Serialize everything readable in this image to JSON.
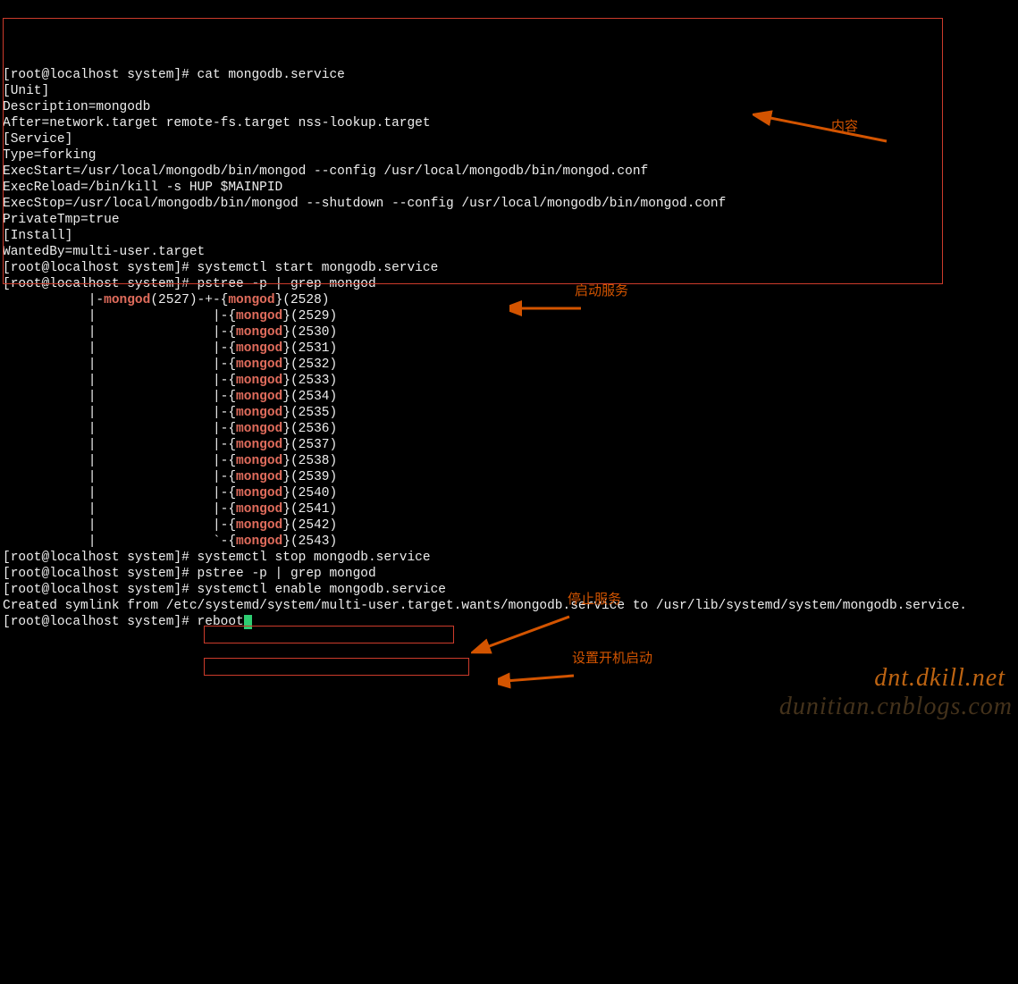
{
  "prompt_user": "root@localhost",
  "prompt_path": "system",
  "cmd_cat": "cat mongodb.service",
  "unit_header": "[Unit]",
  "unit_desc": "Description=mongodb",
  "unit_after": "After=network.target remote-fs.target nss-lookup.target",
  "service_header": "[Service]",
  "service_type": "Type=forking",
  "service_start": "ExecStart=/usr/local/mongodb/bin/mongod --config /usr/local/mongodb/bin/mongod.conf",
  "service_reload": "ExecReload=/bin/kill -s HUP $MAINPID",
  "service_stop": "ExecStop=/usr/local/mongodb/bin/mongod --shutdown --config /usr/local/mongodb/bin/mongod.conf",
  "service_priv": "PrivateTmp=true",
  "install_header": "[Install]",
  "install_wanted": "WantedBy=multi-user.target",
  "cmd_start": "systemctl start mongodb.service",
  "cmd_pstree": "pstree -p | grep mongod",
  "pstree_root_prefix": "           |-",
  "pstree_root_name": "mongod",
  "pstree_root_pid": "(2527)-+-{",
  "pstree_root_pid2": "}(2528)",
  "pstree_pids": [
    "2529",
    "2530",
    "2531",
    "2532",
    "2533",
    "2534",
    "2535",
    "2536",
    "2537",
    "2538",
    "2539",
    "2540",
    "2541",
    "2542"
  ],
  "pstree_last_pid": "2543",
  "cmd_stop": "systemctl stop mongodb.service",
  "cmd_pstree2": "pstree -p | grep mongod",
  "cmd_enable": "systemctl enable mongodb.service",
  "enable_output": "Created symlink from /etc/systemd/system/multi-user.target.wants/mongodb.service to /usr/lib/systemd/system/mongodb.service.",
  "cmd_reboot": "reboot",
  "label_content": "内容",
  "label_start": "启动服务",
  "label_stop": "停止服务",
  "label_enable": "设置开机启动",
  "watermark1": "dnt.dkill.net",
  "watermark2": "dunitian.cnblogs.com"
}
